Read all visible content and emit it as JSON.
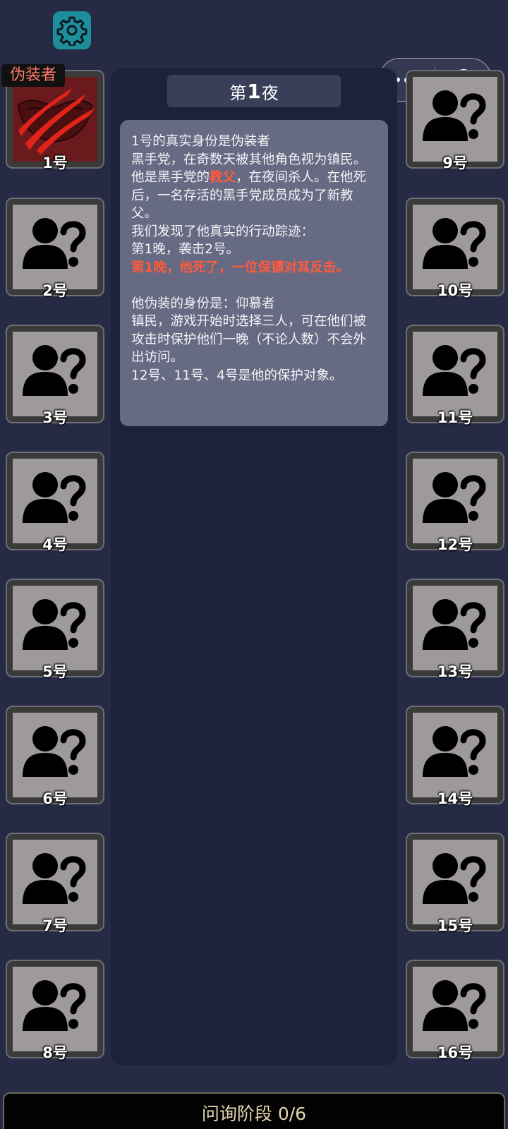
{
  "night": {
    "prefix": "第",
    "number": "1",
    "suffix": "夜"
  },
  "role_tag": "伪装者",
  "info": {
    "line1": "1号的真实身份是伪装者",
    "line2": "黑手党，在奇数天被其他角色视为镇民。",
    "line3_pre": "他是黑手党的",
    "line3_hl": "教父",
    "line3_post": "，在夜间杀人。在他死后，一名存活的黑手党成员成为了新教父。",
    "line4": "我们发现了他真实的行动踪迹：",
    "line5": "第1晚，袭击2号。",
    "line6": "第1晚，他死了，一位保镖对其反击。",
    "line7": "他伪装的身份是：仰慕者",
    "line8": "镇民，游戏开始时选择三人，可在他们被攻击时保护他们一晚（不论人数）不会外出访问。",
    "line9": "12号、11号、4号是他的保护对象。"
  },
  "players": {
    "left": [
      "1号",
      "2号",
      "3号",
      "4号",
      "5号",
      "6号",
      "7号",
      "8号"
    ],
    "right": [
      "9号",
      "10号",
      "11号",
      "12号",
      "13号",
      "14号",
      "15号",
      "16号"
    ]
  },
  "icons": {
    "settings": "gear-icon",
    "unknown_player": "unknown-person-icon",
    "revealed_player": "claw-mask-icon"
  },
  "colors": {
    "background": "#262a45",
    "highlight": "#ff5a3c",
    "role_tag": "#ff7a6a",
    "gear_button": "#1e8e9a"
  },
  "bottom": {
    "phase_label": "问询阶段 0/6"
  }
}
